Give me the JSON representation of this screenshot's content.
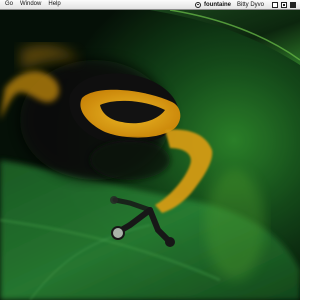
{
  "menubar": {
    "items": [
      "Go",
      "Window",
      "Help"
    ],
    "status": {
      "network_icon": "wifi-icon",
      "network_name": "fountaine",
      "user_name": "Bitty Dyvo",
      "icons": [
        "display-icon",
        "volume-icon",
        "battery-icon"
      ]
    }
  },
  "desktop": {
    "wallpaper_subject": "frog-on-leaf",
    "colors": {
      "leaf_green": "#2f8a33",
      "frog_yellow": "#f0b414",
      "frog_black": "#111111"
    }
  }
}
